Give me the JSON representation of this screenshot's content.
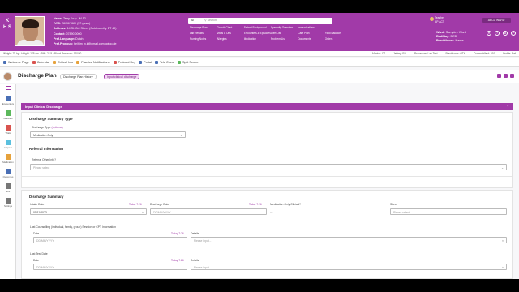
{
  "colors": {
    "brand": "#a13aa8",
    "brand_dark": "#7a2b80",
    "active_tab_bg": "#f3d6f5"
  },
  "header": {
    "logo": "K H S",
    "patient": {
      "name_label": "Name:",
      "name": "Terry Krup - M 52",
      "dob_label": "DOB:",
      "dob": "09/09/1961 (52 years)",
      "address_label": "Address:",
      "address": "14 St. Cdt Street (Coldmoorthy BT 40)",
      "contact_label": "Contact:",
      "contact": "07890 0000",
      "language_label": "Pref.Language:",
      "language": "Dutch",
      "email_label": "Pref.Pronoun:",
      "email": "he/him m.k@gmail.com.optoo.de"
    },
    "search": {
      "scope": "All",
      "placeholder": "Search"
    },
    "quick_links": [
      "Discharge Plan",
      "Growth Chart",
      "Patient Background",
      "Specialty Overview",
      "Immunisations",
      "",
      "Lab Results",
      "Vitals & Obs",
      "Encounters & Episodes",
      "Alert List",
      "Care Plan",
      "Fluid Balance",
      "Nursing Notes",
      "Allergies",
      "Medication",
      "Problem List",
      "Documents",
      "Orders"
    ],
    "user": {
      "name": "Teacher",
      "role": "AP ACT"
    },
    "register_button": "ABCD WARD",
    "ward": {
      "ward_label": "Ward:",
      "ward": "Sample - Ward",
      "bed_label": "Bed/Bay:",
      "bed": "BED",
      "consultant_label": "Practitioner:",
      "consultant": "Name"
    },
    "top_icons": [
      "person",
      "help",
      "settings",
      "logout"
    ]
  },
  "status_bar": {
    "left": "Weight: 75 kg  ·  Height: 175 cm  ·  BMI: 24.5  ·  Blood Pressure: 120/80",
    "right": [
      "Mentor: CT",
      "Jeffrey: RN",
      "Procedure: Lab Test",
      "Practitioner: OTH",
      "Current Ward: 010",
      "Profile: Ref"
    ]
  },
  "toolbar": [
    {
      "label": "Welcome Page",
      "icon": "home-icon",
      "color": "#4a6fb5"
    },
    {
      "label": "Calendar",
      "icon": "calendar-icon",
      "color": "#d9534f"
    },
    {
      "label": "Critical Info",
      "icon": "warning-icon",
      "color": "#e6a23c"
    },
    {
      "label": "Practice Notifications",
      "icon": "bell-icon",
      "color": "#e6a23c"
    },
    {
      "label": "Protocol Key",
      "icon": "key-icon",
      "color": "#d9534f"
    },
    {
      "label": "Portal",
      "icon": "portal-icon",
      "color": "#4a6fb5"
    },
    {
      "label": "Tele Chest",
      "icon": "monitor-icon",
      "color": "#4a6fb5"
    },
    {
      "label": "Split Screen",
      "icon": "split-icon",
      "color": "#5cb85c"
    }
  ],
  "page": {
    "title": "Discharge Plan",
    "tabs": [
      "Discharge Plan History",
      "Input clinical discharge"
    ]
  },
  "sidenav": [
    {
      "label": "",
      "color": "#a13aa8"
    },
    {
      "label": "Encounters",
      "color": "#4a6fb5"
    },
    {
      "label": "Activities",
      "color": "#5cb85c"
    },
    {
      "label": "Vitals",
      "color": "#d9534f"
    },
    {
      "label": "Inspect",
      "color": "#5bc0de"
    },
    {
      "label": "Medication",
      "color": "#e6a23c"
    },
    {
      "label": "Outcomes",
      "color": "#4a6fb5"
    },
    {
      "label": "IAS",
      "color": "#777777"
    },
    {
      "label": "Settings",
      "color": "#777777"
    }
  ],
  "form": {
    "section_bar": "Input Clinical Discharge",
    "summary_type": {
      "heading": "Discharge Summary Type",
      "label": "Discharge Type",
      "optional": "(optional)",
      "value": "Medication Only"
    },
    "referral": {
      "heading": "Referral Information",
      "label": "Referral Other Info?",
      "placeholder": "Please select"
    },
    "summary": {
      "heading": "Discharge Summary",
      "intake_date_label": "Intake Date",
      "intake_today": "Today 7:26",
      "intake_date": "01/11/2023",
      "discharge_date_label": "Discharge Date",
      "discharge_today": "Today 7:26",
      "discharge_date": "DD/MM/YYYY",
      "meds_label": "Medication Only Clinical?",
      "meds_value": "—",
      "sites_label": "Sites",
      "sites_placeholder": "Please select",
      "counselling_label": "Last Counselling (individual, family, group) Session or CPT Information",
      "counselling_date_label": "Date",
      "counselling_today": "Today 7:26",
      "counselling_date": "DD/MM/YYYY",
      "counselling_details_label": "Details",
      "counselling_details": "Please input...",
      "lasttest_label": "Last Test Date",
      "lasttest_date_label": "Date",
      "lasttest_today": "Today 7:26",
      "lasttest_date": "DD/MM/YYYY",
      "lasttest_details_label": "Details",
      "lasttest_details": "Please input..."
    }
  }
}
